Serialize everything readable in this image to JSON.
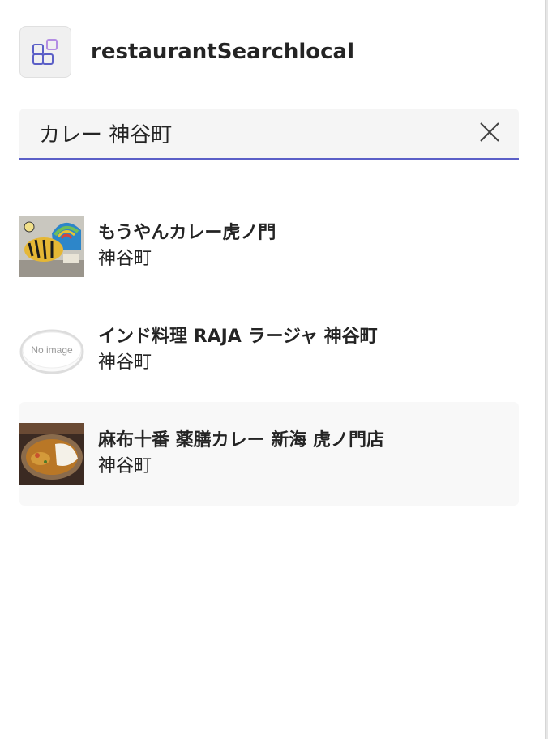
{
  "app": {
    "title": "restaurantSearchlocal",
    "icon": "apps-grid-icon"
  },
  "search": {
    "value": "カレー 神谷町",
    "clear_icon": "close-icon"
  },
  "results": [
    {
      "name": "もうやんカレー虎ノ門",
      "area": "神谷町",
      "thumbnail": "tiger-painting-image"
    },
    {
      "name": "インド料理 RAJA ラージャ 神谷町",
      "area": "神谷町",
      "thumbnail": "no-image-placeholder",
      "thumbnail_text": "No image"
    },
    {
      "name": "麻布十番 薬膳カレー 新海 虎ノ門店",
      "area": "神谷町",
      "thumbnail": "curry-dish-image",
      "selected": true
    }
  ],
  "colors": {
    "accent": "#5b5fc7",
    "text": "#242424",
    "search_bg": "#f5f5f5",
    "selected_bg": "#f8f8f8"
  }
}
